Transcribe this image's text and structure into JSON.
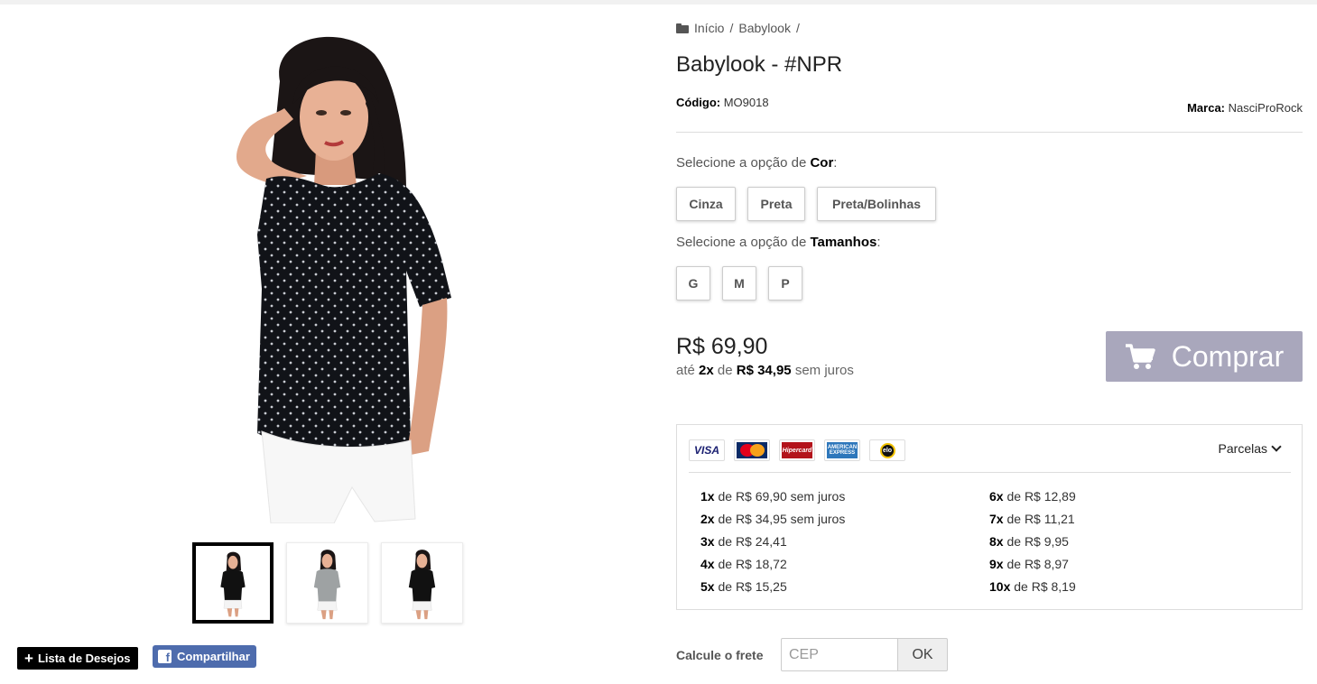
{
  "breadcrumb": {
    "home": "Início",
    "category": "Babylook",
    "separator": "/"
  },
  "product": {
    "title": "Babylook - #NPR",
    "code_label": "Código:",
    "code": "MO9018",
    "brand_label": "Marca:",
    "brand": "NasciProRock"
  },
  "options": {
    "color": {
      "prefix": "Selecione a opção de",
      "name": "Cor",
      "suffix": ":",
      "values": [
        "Cinza",
        "Preta",
        "Preta/Bolinhas"
      ]
    },
    "size": {
      "prefix": "Selecione a opção de",
      "name": "Tamanhos",
      "suffix": ":",
      "values": [
        "G",
        "M",
        "P"
      ]
    }
  },
  "pricing": {
    "price": "R$ 69,90",
    "inst_prefix": "até",
    "inst_count": "2x",
    "inst_de": "de",
    "inst_value": "R$ 34,95",
    "inst_suffix": "sem juros"
  },
  "buy_button": {
    "label": "Comprar",
    "color": "#a9a7bc"
  },
  "payment": {
    "cards": [
      "VISA",
      "MasterCard",
      "Hipercard",
      "AMERICAN EXPRESS",
      "elo"
    ],
    "parcelas_label": "Parcelas",
    "installments_left": [
      {
        "n": "1x",
        "de": "de",
        "v": "R$ 69,90 sem juros"
      },
      {
        "n": "2x",
        "de": "de",
        "v": "R$ 34,95 sem juros"
      },
      {
        "n": "3x",
        "de": "de",
        "v": "R$ 24,41"
      },
      {
        "n": "4x",
        "de": "de",
        "v": "R$ 18,72"
      },
      {
        "n": "5x",
        "de": "de",
        "v": "R$ 15,25"
      }
    ],
    "installments_right": [
      {
        "n": "6x",
        "de": "de",
        "v": "R$ 12,89"
      },
      {
        "n": "7x",
        "de": "de",
        "v": "R$ 11,21"
      },
      {
        "n": "8x",
        "de": "de",
        "v": "R$ 9,95"
      },
      {
        "n": "9x",
        "de": "de",
        "v": "R$ 8,97"
      },
      {
        "n": "10x",
        "de": "de",
        "v": "R$ 8,19"
      }
    ]
  },
  "shipping": {
    "label": "Calcule o frete",
    "placeholder": "CEP",
    "ok_label": "OK"
  },
  "actions": {
    "wishlist_label": "Lista de Desejos",
    "share_label": "Compartilhar",
    "share_color": "#4e6cad"
  },
  "gallery": {
    "shirt_colors": [
      "#111111",
      "#9ea2a3",
      "#111111"
    ]
  }
}
